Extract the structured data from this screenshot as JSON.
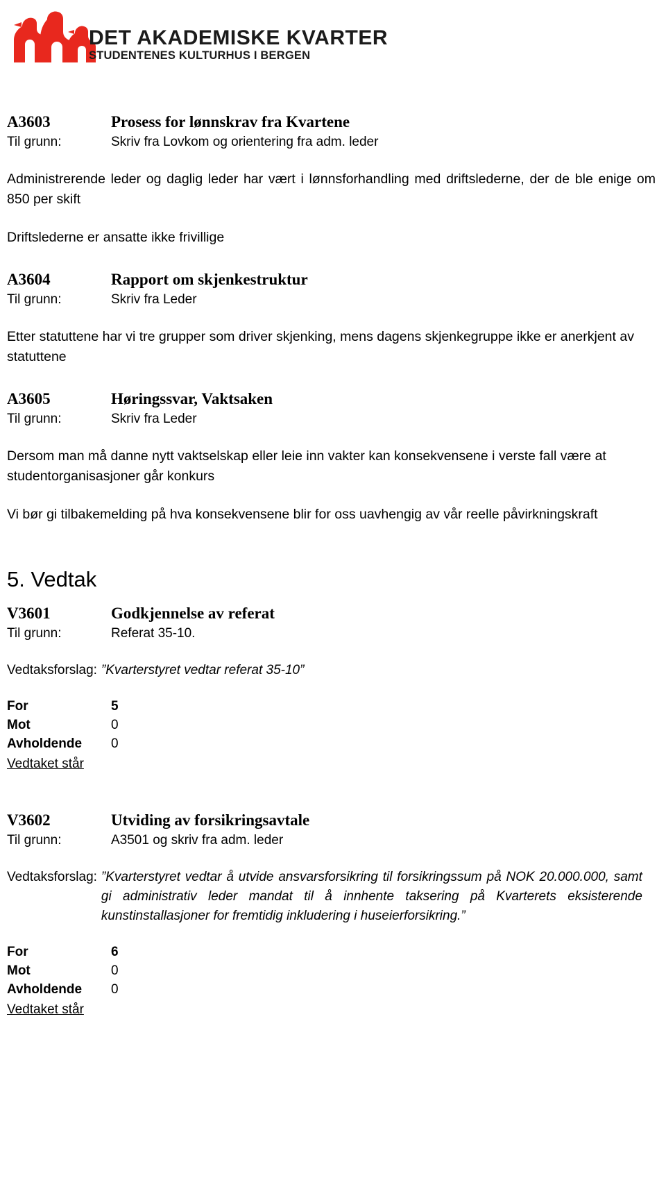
{
  "header": {
    "logo_icon": "three-penguins-logo",
    "org_name": "DET AKADEMISKE KVARTER",
    "org_tagline": "STUDENTENES KULTURHUS I BERGEN",
    "brand_color": "#E8281E"
  },
  "labels": {
    "basis": "Til grunn:",
    "proposal": "Vedtaksforslag:",
    "for": "For",
    "against": "Mot",
    "abstain": "Avholdende",
    "result_stands": "Vedtaket står"
  },
  "orientation_cases": [
    {
      "id": "A3603",
      "title": "Prosess for lønnskrav fra Kvartene",
      "basis": "Skriv fra Lovkom og orientering fra adm. leder",
      "paragraphs": [
        "Administrerende leder og daglig leder har vært i lønnsforhandling med driftslederne, der de ble enige om 850 per skift",
        "Driftslederne er ansatte ikke frivillige"
      ]
    },
    {
      "id": "A3604",
      "title": "Rapport om skjenkestruktur",
      "basis": "Skriv fra Leder",
      "paragraphs": [
        "Etter statuttene har vi tre grupper som driver skjenking, mens dagens skjenkegruppe ikke er anerkjent av statuttene"
      ]
    },
    {
      "id": "A3605",
      "title": "Høringssvar, Vaktsaken",
      "basis": "Skriv fra Leder",
      "paragraphs": [
        "Dersom man må danne nytt vaktselskap eller leie inn vakter kan konsekvensene i verste fall være at studentorganisasjoner går konkurs",
        "Vi bør gi tilbakemelding på hva konsekvensene blir for oss uavhengig av vår reelle påvirkningskraft"
      ]
    }
  ],
  "decisions_section": {
    "heading": "5. Vedtak",
    "items": [
      {
        "id": "V3601",
        "title": "Godkjennelse av referat",
        "basis": "Referat 35-10.",
        "proposal": "”Kvarterstyret vedtar referat 35-10”",
        "votes": {
          "for": "5",
          "against": "0",
          "abstain": "0"
        },
        "result": "Vedtaket står"
      },
      {
        "id": "V3602",
        "title": "Utviding av forsikringsavtale",
        "basis": "A3501 og skriv fra adm. leder",
        "proposal": "”Kvarterstyret vedtar å utvide ansvarsforsikring til forsikringssum på NOK 20.000.000, samt gi administrativ leder mandat til å innhente taksering på Kvarterets eksisterende kunstinstallasjoner for fremtidig inkludering i huseierforsikring.”",
        "votes": {
          "for": "6",
          "against": "0",
          "abstain": "0"
        },
        "result": "Vedtaket står"
      }
    ]
  }
}
